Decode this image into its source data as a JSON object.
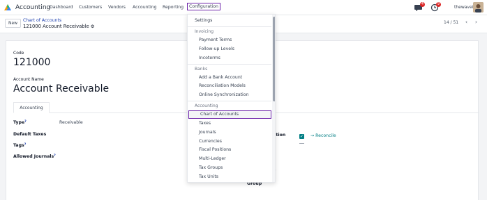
{
  "app": {
    "title": "Accounting"
  },
  "menu": [
    {
      "label": "Dashboard"
    },
    {
      "label": "Customers"
    },
    {
      "label": "Vendors"
    },
    {
      "label": "Accounting"
    },
    {
      "label": "Reporting"
    },
    {
      "label": "Configuration"
    }
  ],
  "systray": {
    "discuss_count": "4",
    "activity_count": "9",
    "company": "thewaveinfo"
  },
  "control": {
    "new_label": "New",
    "breadcrumb": "Chart of Accounts",
    "record": "121000 Account Receivable",
    "pager": "14 / 51"
  },
  "form": {
    "code_label": "Code",
    "code_value": "121000",
    "name_label": "Account Name",
    "name_value": "Account Receivable",
    "tab": "Accounting",
    "type_label": "Type",
    "type_value": "Receivable",
    "taxes_label": "Default Taxes",
    "tags_label": "Tags",
    "journals_label": "Allowed Journals",
    "help_mark": "?",
    "reconcile_label": "iliation",
    "reconcile_link": "Reconcile",
    "right_text_1": "re",
    "right_text_2": "ort",
    "right_text_3": "Group"
  },
  "dropdown": {
    "items": [
      {
        "label": "Settings",
        "kind": "top"
      },
      {
        "label": "Invoicing",
        "kind": "section"
      },
      {
        "label": "Payment Terms",
        "kind": "sub"
      },
      {
        "label": "Follow-up Levels",
        "kind": "sub"
      },
      {
        "label": "Incoterms",
        "kind": "sub"
      },
      {
        "label": "Banks",
        "kind": "section"
      },
      {
        "label": "Add a Bank Account",
        "kind": "sub"
      },
      {
        "label": "Reconciliation Models",
        "kind": "sub"
      },
      {
        "label": "Online Synchronization",
        "kind": "sub"
      },
      {
        "label": "Accounting",
        "kind": "section"
      },
      {
        "label": "Chart of Accounts",
        "kind": "sub",
        "selected": true
      },
      {
        "label": "Taxes",
        "kind": "sub"
      },
      {
        "label": "Journals",
        "kind": "sub"
      },
      {
        "label": "Currencies",
        "kind": "sub"
      },
      {
        "label": "Fiscal Positions",
        "kind": "sub"
      },
      {
        "label": "Multi-Ledger",
        "kind": "sub"
      },
      {
        "label": "Tax Groups",
        "kind": "sub"
      },
      {
        "label": "Tax Units",
        "kind": "sub"
      }
    ]
  },
  "colors": {
    "accent": "#6b21a8",
    "link": "#017e84",
    "badge": "#dc2626"
  }
}
